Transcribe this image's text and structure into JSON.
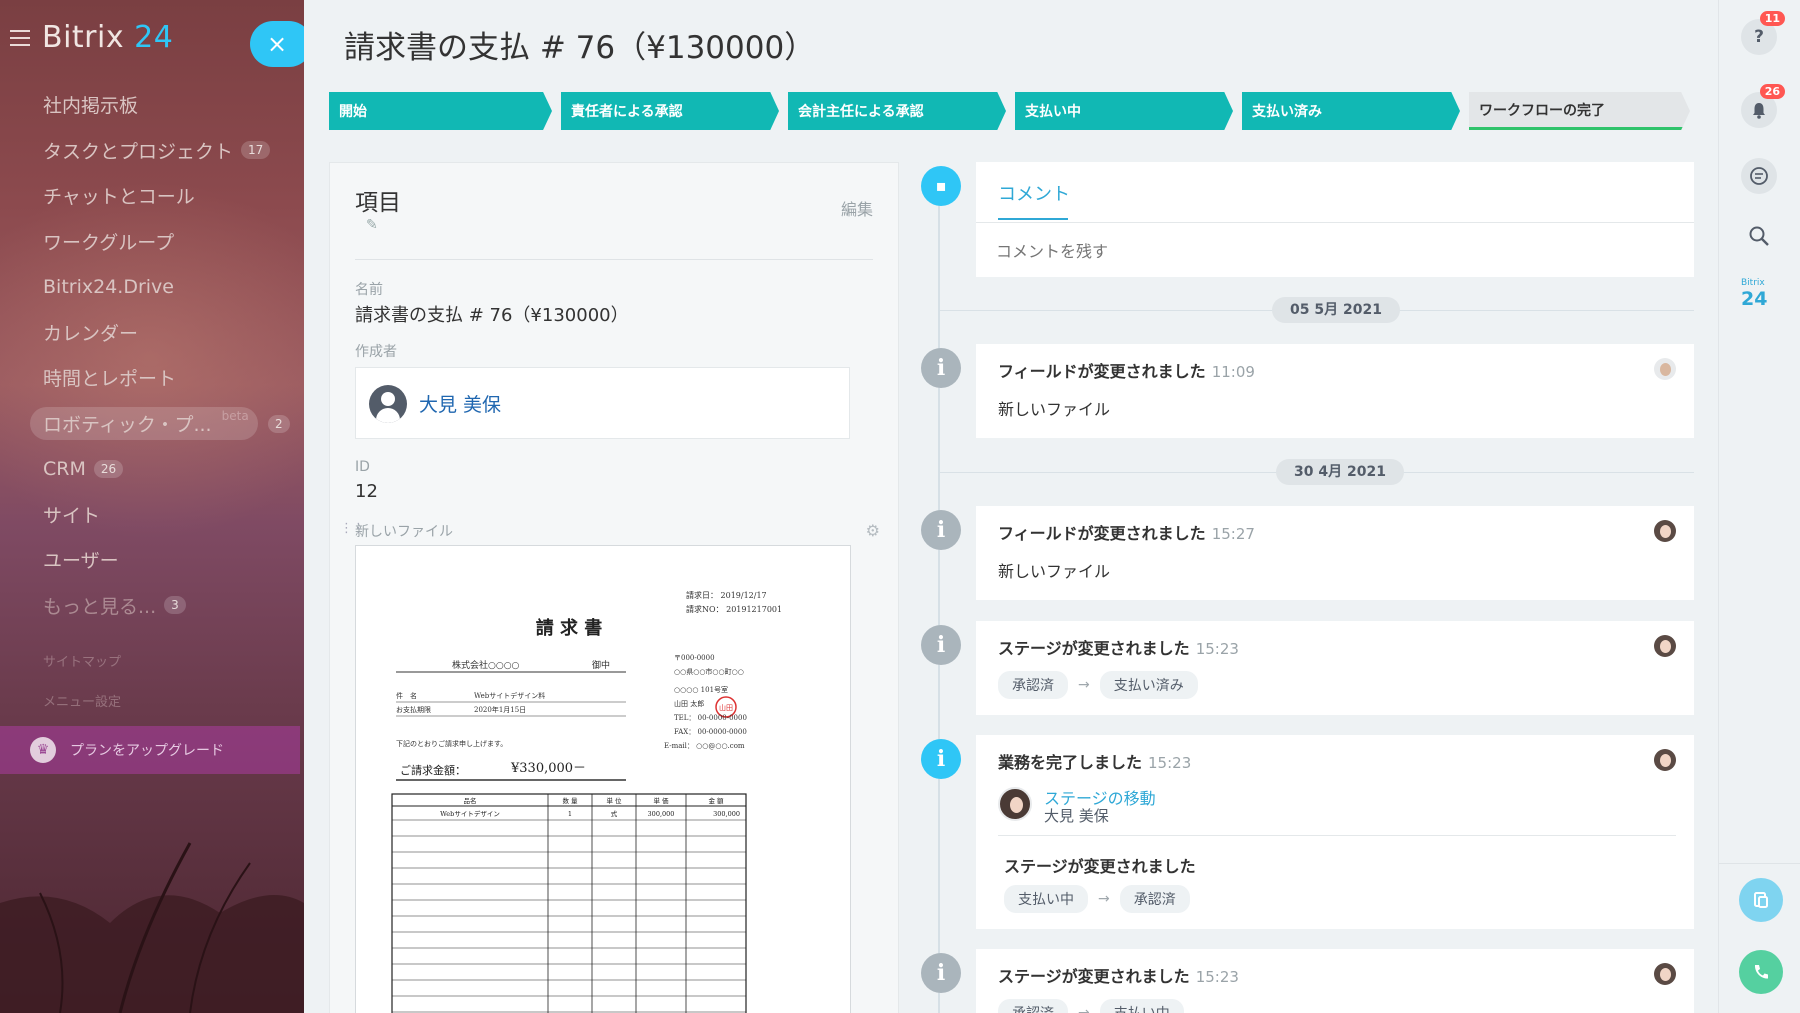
{
  "app": {
    "logo_text": "Bitrix",
    "logo_num": "24",
    "close_label": "×"
  },
  "sidebar": {
    "items": [
      {
        "label": "社内掲示板"
      },
      {
        "label": "タスクとプロジェクト",
        "count": "17"
      },
      {
        "label": "チャットとコール"
      },
      {
        "label": "ワークグループ"
      },
      {
        "label": "Bitrix24.Drive"
      },
      {
        "label": "カレンダー"
      },
      {
        "label": "時間とレポート"
      },
      {
        "label": "ロボティック・プ...",
        "beta": "beta",
        "count": "2"
      },
      {
        "label": "CRM",
        "count": "26"
      },
      {
        "label": "サイト"
      },
      {
        "label": "ユーザー"
      },
      {
        "label": "もっと見る...",
        "count": "3"
      }
    ],
    "sitemap": "サイトマップ",
    "menu_settings": "メニュー設定",
    "upgrade": "プランをアップグレード"
  },
  "header": {
    "title": "請求書の支払 # 76（¥130000）"
  },
  "stages": [
    {
      "label": "開始"
    },
    {
      "label": "責任者による承認"
    },
    {
      "label": "会計主任による承認"
    },
    {
      "label": "支払い中"
    },
    {
      "label": "支払い済み"
    },
    {
      "label": "ワークフローの完了"
    }
  ],
  "details": {
    "section_title": "項目",
    "edit": "編集",
    "name_label": "名前",
    "name_value": "請求書の支払 # 76（¥130000）",
    "creator_label": "作成者",
    "creator_name": "大見 美保",
    "id_label": "ID",
    "id_value": "12",
    "file_label": "新しいファイル"
  },
  "invoice": {
    "title": "請 求 書",
    "date": "請求日： 2019/12/17",
    "no": "請求NO： 20191217001",
    "client": "株式会社○○○○",
    "honorific": "御中",
    "subject_label": "件　名",
    "subject_value": "Webサイトデザイン料",
    "due_label": "お支払期限",
    "due_value": "2020年1月15日",
    "note": "下記のとおりご請求申し上げます。",
    "total_label": "ご請求金額：",
    "total_value": "¥330,000－",
    "address": [
      "〒000-0000",
      "○○県○○市○○町○○",
      "○○○○ 101号室",
      "山田 太郎",
      "TEL： 00-0000-0000",
      "FAX： 00-0000-0000",
      "E-mail： ○○@○○.com"
    ],
    "seal": "山田",
    "table_headers": [
      "品名",
      "数 量",
      "単 位",
      "単 価",
      "金 額"
    ],
    "table_row": [
      "Webサイトデザイン",
      "1",
      "式",
      "300,000",
      "300,000"
    ]
  },
  "timeline": {
    "comment_tab": "コメント",
    "comment_placeholder": "コメントを残す",
    "date1": "05 5月 2021",
    "date2": "30 4月 2021",
    "events": [
      {
        "title": "フィールドが変更されました",
        "time": "11:09",
        "sub": "新しいファイル"
      },
      {
        "title": "フィールドが変更されました",
        "time": "15:27",
        "sub": "新しいファイル"
      },
      {
        "title": "ステージが変更されました",
        "time": "15:23",
        "from": "承認済",
        "to": "支払い済み"
      },
      {
        "title": "業務を完了しました",
        "time": "15:23",
        "link": "ステージの移動",
        "user": "大見 美保",
        "sub_title": "ステージが変更されました",
        "from": "支払い中",
        "to": "承認済"
      },
      {
        "title": "ステージが変更されました",
        "time": "15:23",
        "from": "承認済",
        "to": "支払い中"
      }
    ]
  },
  "rightbar": {
    "help_badge": "11",
    "notify_badge": "26",
    "logo_small": "Bitrix",
    "logo_big": "24"
  },
  "colors": {
    "accent": "#2fc6f6",
    "stage": "#11b8b4",
    "badge": "#ff5752",
    "phone": "#55d0a0"
  }
}
